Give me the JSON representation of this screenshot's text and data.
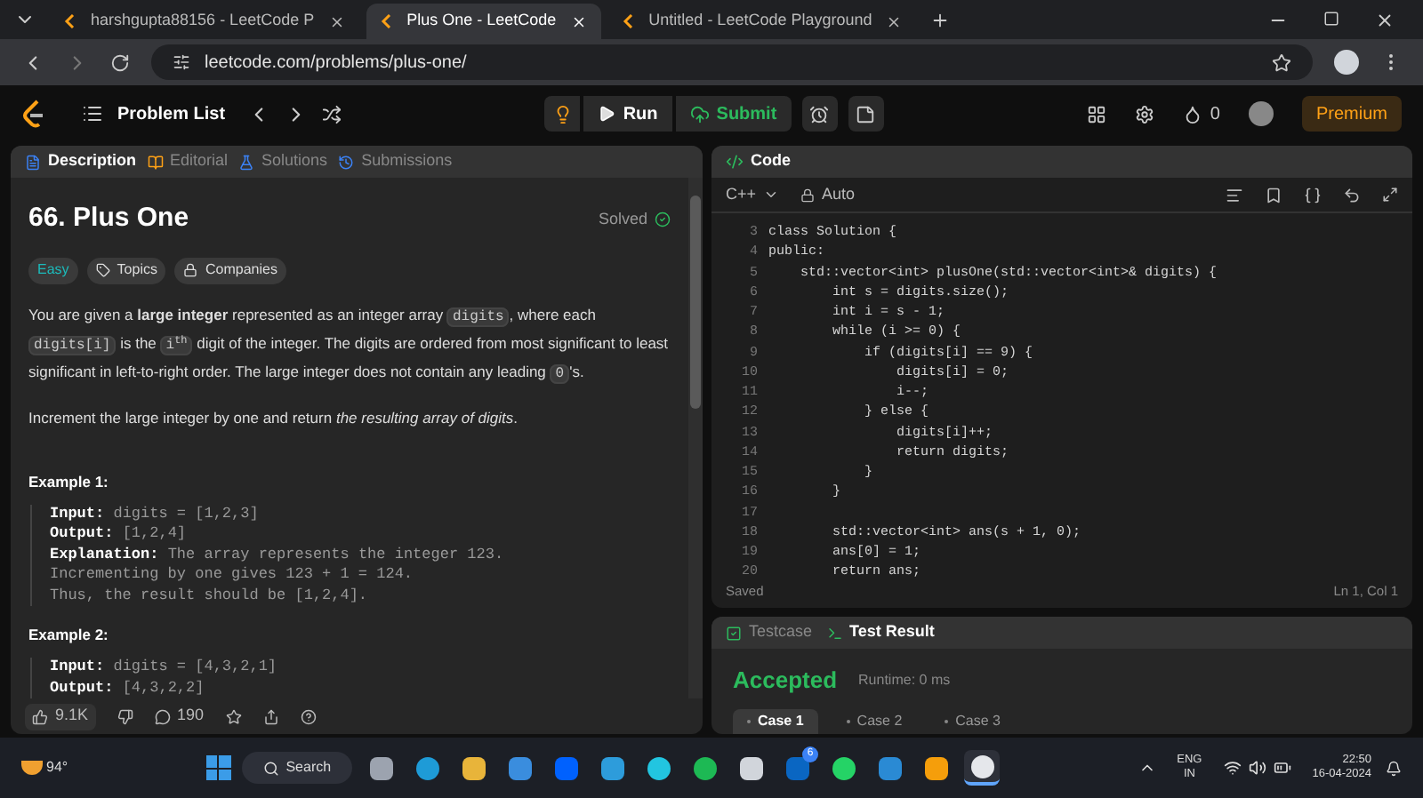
{
  "browser": {
    "tabs": [
      {
        "title": "harshgupta88156 - LeetCode P",
        "selected": false
      },
      {
        "title": "Plus One - LeetCode",
        "selected": true
      },
      {
        "title": "Untitled - LeetCode Playground",
        "selected": false
      }
    ],
    "url": "leetcode.com/problems/plus-one/"
  },
  "toolbar": {
    "problem_list": "Problem List",
    "run": "Run",
    "submit": "Submit",
    "streak": "0",
    "premium": "Premium"
  },
  "description": {
    "tabs": [
      {
        "label": "Description",
        "selected": true
      },
      {
        "label": "Editorial",
        "selected": false
      },
      {
        "label": "Solutions",
        "selected": false
      },
      {
        "label": "Submissions",
        "selected": false
      }
    ],
    "title": "66. Plus One",
    "status": "Solved",
    "tags": [
      {
        "kind": "difficulty",
        "label": "Easy"
      },
      {
        "kind": "topics",
        "label": "Topics"
      },
      {
        "kind": "companies",
        "label": "Companies"
      }
    ],
    "paragraphs": [
      [
        {
          "kind": "text",
          "text": "You are given a **large integer** represented as an integer array "
        },
        {
          "kind": "code",
          "text": "digits"
        },
        {
          "kind": "text",
          "text": ", where each "
        },
        {
          "kind": "code",
          "text": "digits[i]"
        },
        {
          "kind": "text",
          "text": " is the "
        },
        {
          "kind": "code",
          "text": "i$^{th}$"
        },
        {
          "kind": "text",
          "text": " digit of the integer. The digits are ordered from most significant to least significant in left-to-right order. The large integer does not contain any leading "
        },
        {
          "kind": "code",
          "text": "0"
        },
        {
          "kind": "text",
          "text": "'s."
        }
      ],
      [
        {
          "kind": "text",
          "text": "Increment the large integer by one and return *the resulting array of digits*."
        }
      ]
    ],
    "examples": [
      {
        "heading": "Example 1:",
        "lines": [
          {
            "label": "Input:",
            "text": "digits = [1,2,3]"
          },
          {
            "label": "Output:",
            "text": "[1,2,4]"
          },
          {
            "label": "Explanation:",
            "text": "The array represents the integer 123."
          },
          {
            "text": "Incrementing by one gives 123 + 1 = 124."
          },
          {
            "text": "Thus, the result should be [1,2,4]."
          }
        ]
      },
      {
        "heading": "Example 2:",
        "lines": [
          {
            "label": "Input:",
            "text": "digits = [4,3,2,1]"
          },
          {
            "label": "Output:",
            "text": "[4,3,2,2]"
          }
        ]
      }
    ],
    "likes": "9.1K",
    "comments": "190"
  },
  "code": {
    "title": "Code",
    "language": "C++",
    "mode": "Auto",
    "lines": [
      {
        "number": "3",
        "text": "class Solution {"
      },
      {
        "number": "4",
        "text": "public:"
      },
      {
        "number": "5",
        "text": "    std::vector<int> plusOne(std::vector<int>& digits) {"
      },
      {
        "number": "6",
        "text": "        int s = digits.size();"
      },
      {
        "number": "7",
        "text": "        int i = s - 1;"
      },
      {
        "number": "8",
        "text": "        while (i >= 0) {"
      },
      {
        "number": "9",
        "text": "            if (digits[i] == 9) {"
      },
      {
        "number": "10",
        "text": "                digits[i] = 0;"
      },
      {
        "number": "11",
        "text": "                i--;"
      },
      {
        "number": "12",
        "text": "            } else {"
      },
      {
        "number": "13",
        "text": "                digits[i]++;"
      },
      {
        "number": "14",
        "text": "                return digits;"
      },
      {
        "number": "15",
        "text": "            }"
      },
      {
        "number": "16",
        "text": "        }"
      },
      {
        "number": "17"
      },
      {
        "number": "18",
        "text": "        std::vector<int> ans(s + 1, 0);"
      },
      {
        "number": "19",
        "text": "        ans[0] = 1;"
      },
      {
        "number": "20",
        "text": "        return ans;"
      }
    ],
    "status": "Saved",
    "cursor": "Ln 1, Col 1"
  },
  "tests": {
    "tabs": [
      {
        "label": "Testcase",
        "selected": false
      },
      {
        "label": "Test Result",
        "selected": true
      }
    ],
    "verdict": "Accepted",
    "runtime": "Runtime: 0 ms",
    "cases": [
      {
        "label": "Case 1",
        "selected": true
      },
      {
        "label": "Case 2",
        "selected": false
      },
      {
        "label": "Case 3",
        "selected": false
      }
    ]
  },
  "taskbar": {
    "weather": "94°",
    "search": "Search",
    "apps": [
      {
        "kind": "windows",
        "selected": false
      },
      {
        "kind": "taskview",
        "selected": false
      },
      {
        "kind": "edge",
        "selected": false
      },
      {
        "kind": "folder",
        "selected": false
      },
      {
        "kind": "mail",
        "selected": false
      },
      {
        "kind": "dropbox",
        "selected": false
      },
      {
        "kind": "wave",
        "selected": false
      },
      {
        "kind": "ring",
        "selected": false
      },
      {
        "kind": "spotify",
        "selected": false
      },
      {
        "kind": "doc",
        "selected": false
      },
      {
        "kind": "linkedin",
        "badge": "6",
        "selected": false
      },
      {
        "kind": "whatsapp",
        "selected": false
      },
      {
        "kind": "vscode",
        "selected": false
      },
      {
        "kind": "sublime",
        "selected": false
      },
      {
        "kind": "chrome",
        "selected": true
      }
    ],
    "language": "ENG",
    "region": "IN",
    "time": "22:50",
    "date": "16-04-2024"
  }
}
